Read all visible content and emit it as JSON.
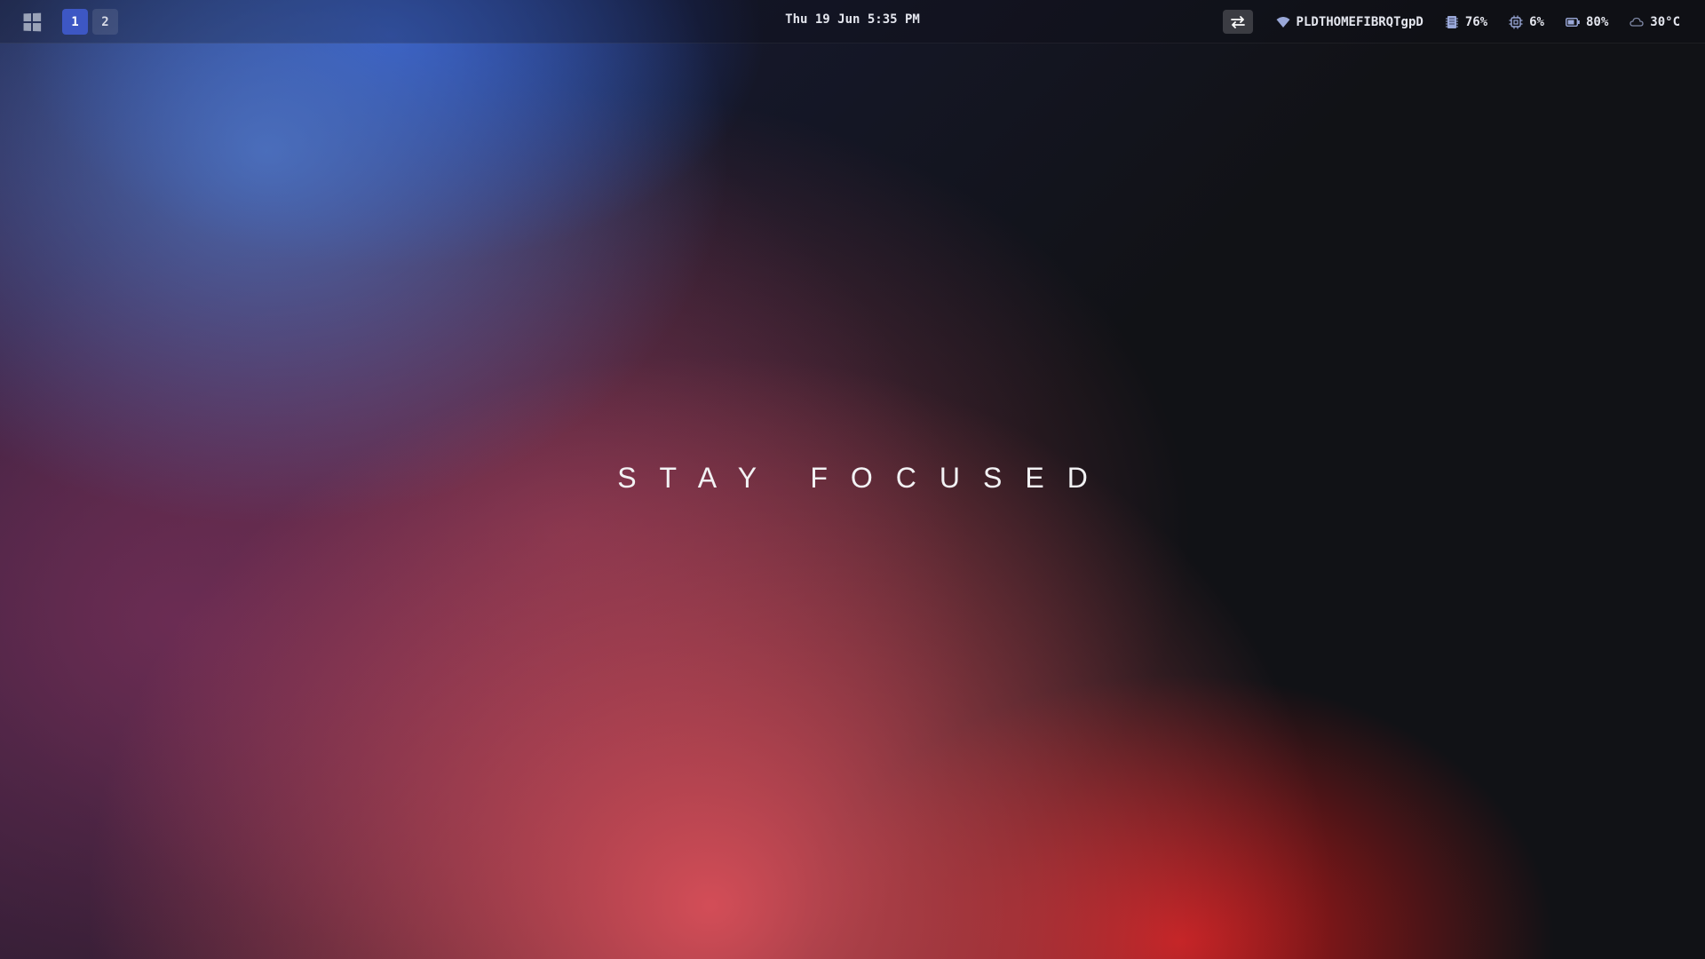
{
  "topbar": {
    "start_icon": "windows-logo-icon",
    "workspaces": [
      {
        "label": "1",
        "active": true
      },
      {
        "label": "2",
        "active": false
      }
    ],
    "clock": "Thu 19 Jun 5:35 PM",
    "swap_icon": "swap-arrows-icon",
    "stats": {
      "wifi": {
        "icon": "wifi-icon",
        "text": "PLDTHOMEFIBRQTgpD"
      },
      "memory": {
        "icon": "memory-icon",
        "text": "76%"
      },
      "cpu": {
        "icon": "cpu-icon",
        "text": "6%"
      },
      "battery": {
        "icon": "battery-icon",
        "text": "80%"
      },
      "weather": {
        "icon": "cloud-icon",
        "text": "30°C"
      }
    }
  },
  "wallpaper": {
    "motto": "STAY FOCUSED"
  },
  "colors": {
    "accent": "#3d57c4",
    "bar_text": "#e4e6ee",
    "icon": "#9aa3b8"
  }
}
